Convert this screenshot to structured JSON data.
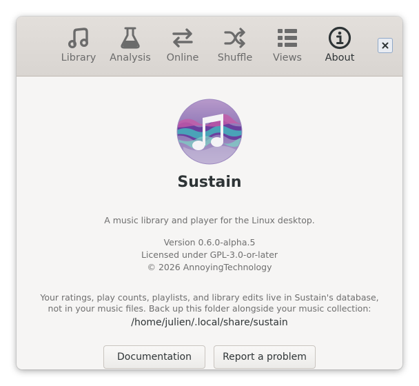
{
  "tabs": [
    {
      "label": "Library",
      "icon": "music-notes-icon"
    },
    {
      "label": "Analysis",
      "icon": "flask-icon"
    },
    {
      "label": "Online",
      "icon": "arrows-exchange-icon"
    },
    {
      "label": "Shuffle",
      "icon": "shuffle-icon"
    },
    {
      "label": "Views",
      "icon": "list-view-icon"
    },
    {
      "label": "About",
      "icon": "info-icon",
      "active": true
    }
  ],
  "close_icon": "close-icon",
  "about": {
    "app_name": "Sustain",
    "description": "A music library and player for the Linux desktop.",
    "version": "Version 0.6.0-alpha.5",
    "license": "Licensed under GPL-3.0-or-later",
    "copyright": "© 2026 AnnoyingTechnology",
    "data_note_line1": "Your ratings, play counts, playlists, and library edits live in Sustain's database,",
    "data_note_line2": "not in your music files. Back up this folder alongside your music collection:",
    "data_path": "/home/julien/.local/share/sustain"
  },
  "buttons": {
    "documentation": "Documentation",
    "report": "Report a problem"
  },
  "colors": {
    "headerbar": "#dcd8d4",
    "background": "#f6f5f4",
    "text_primary": "#2e3436",
    "text_secondary": "#6f6f6f"
  }
}
